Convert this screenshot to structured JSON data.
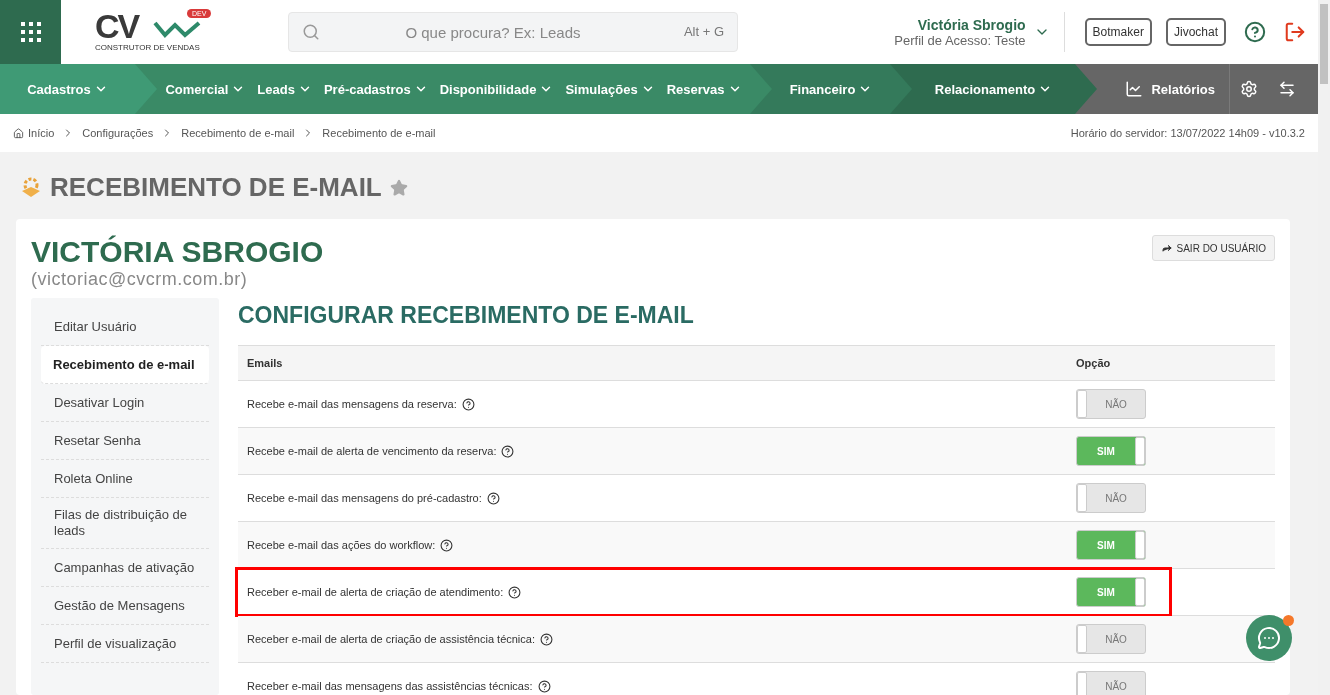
{
  "header": {
    "logo": {
      "letters": "CV",
      "badge": "DEV",
      "tagline": "CONSTRUTOR DE VENDAS"
    },
    "search": {
      "placeholder": "O que procura? Ex: Leads",
      "shortcut": "Alt + G"
    },
    "user": {
      "name": "Victória Sbrogio",
      "profile": "Perfil de Acesso: Teste"
    },
    "buttons": [
      "Botmaker",
      "Jivochat"
    ]
  },
  "nav": {
    "groups": [
      {
        "items": [
          "Cadastros"
        ]
      },
      {
        "items": [
          "Comercial",
          "Leads",
          "Pré-cadastros",
          "Disponibilidade",
          "Simulações",
          "Reservas"
        ]
      },
      {
        "items": [
          "Financeiro"
        ]
      },
      {
        "items": [
          "Relacionamento"
        ]
      }
    ],
    "reports": "Relatórios"
  },
  "breadcrumb": {
    "items": [
      "Início",
      "Configurações",
      "Recebimento de e-mail",
      "Recebimento de e-mail"
    ],
    "server_time": "Horário do servidor: 13/07/2022 14h09 - v10.3.2"
  },
  "page_title": "RECEBIMENTO DE E-MAIL",
  "profile": {
    "name": "VICTÓRIA SBROGIO",
    "email": "(victoriac@cvcrm.com.br)",
    "exit_button": "SAIR DO USUÁRIO"
  },
  "sidebar": {
    "items": [
      {
        "label": "Editar Usuário",
        "selected": false
      },
      {
        "label": "Recebimento de e-mail",
        "selected": true
      },
      {
        "label": "Desativar Login",
        "selected": false
      },
      {
        "label": "Resetar Senha",
        "selected": false
      },
      {
        "label": "Roleta Online",
        "selected": false
      },
      {
        "label": "Filas de distribuição de leads",
        "selected": false
      },
      {
        "label": "Campanhas de ativação",
        "selected": false
      },
      {
        "label": "Gestão de Mensagens",
        "selected": false
      },
      {
        "label": "Perfil de visualização",
        "selected": false
      }
    ]
  },
  "settings": {
    "title": "CONFIGURAR RECEBIMENTO DE E-MAIL",
    "columns": [
      "Emails",
      "Opção"
    ],
    "rows": [
      {
        "label": "Recebe e-mail das mensagens da reserva:",
        "on": false,
        "option": "NÃO",
        "highlighted": false
      },
      {
        "label": "Recebe e-mail de alerta de vencimento da reserva:",
        "on": true,
        "option": "SIM",
        "highlighted": false
      },
      {
        "label": "Recebe e-mail das mensagens do pré-cadastro:",
        "on": false,
        "option": "NÃO",
        "highlighted": false
      },
      {
        "label": "Recebe e-mail das ações do workflow:",
        "on": true,
        "option": "SIM",
        "highlighted": false
      },
      {
        "label": "Receber e-mail de alerta de criação de atendimento:",
        "on": true,
        "option": "SIM",
        "highlighted": true
      },
      {
        "label": "Receber e-mail de alerta de criação de assistência técnica:",
        "on": false,
        "option": "NÃO",
        "highlighted": false
      },
      {
        "label": "Receber e-mail das mensagens das assistências técnicas:",
        "on": false,
        "option": "NÃO",
        "highlighted": false
      }
    ]
  }
}
